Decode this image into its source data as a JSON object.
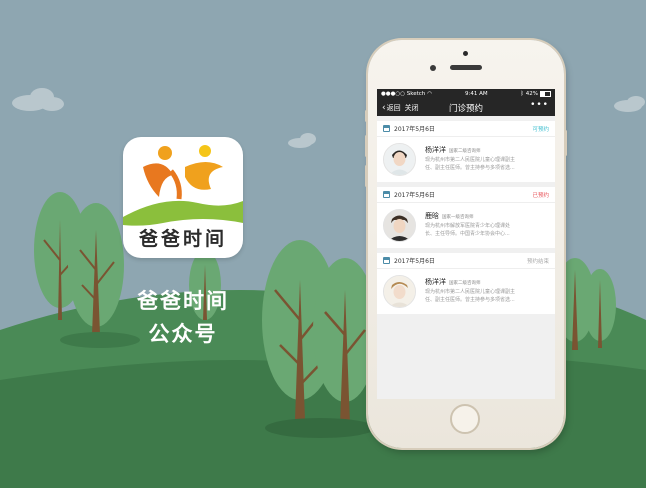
{
  "app": {
    "icon_text": "爸爸时间",
    "title_line1": "爸爸时间",
    "title_line2": "公众号"
  },
  "status_bar": {
    "carrier": "●●●○○ Sketch",
    "time": "9:41 AM",
    "battery": "42%"
  },
  "nav": {
    "back": "返回",
    "close": "关闭",
    "title": "门诊预约",
    "more": "•••"
  },
  "appointments": [
    {
      "date": "2017年5月6日",
      "status": "可预约",
      "status_color": "#3fbfd0",
      "name": "杨洋洋",
      "title": "国家二级咨询师",
      "desc_line1": "现为杭州市第二人民医院儿童心理课副主",
      "desc_line2": "任、副主任医师。曾主持参与多项省选..."
    },
    {
      "date": "2017年5月6日",
      "status": "已预约",
      "status_color": "#e8545a",
      "name": "鹿晗",
      "title": "国家一级咨询师",
      "desc_line1": "现为杭州市解放军医院青少年心理课处",
      "desc_line2": "长、主任导师。中国青少年协会中心..."
    },
    {
      "date": "2017年5月6日",
      "status": "预约结束",
      "status_color": "#aaaaaa",
      "name": "杨洋洋",
      "title": "国家二级咨询师",
      "desc_line1": "现为杭州市第二人民医院儿童心理课副主",
      "desc_line2": "任、副主任医师。曾主持参与多项省选..."
    }
  ],
  "colors": {
    "sky": "#8ea6b1",
    "hill": "#3e7a4a",
    "tree": "#6aa873",
    "trunk": "#7a5432",
    "nav_bg": "#262626"
  }
}
